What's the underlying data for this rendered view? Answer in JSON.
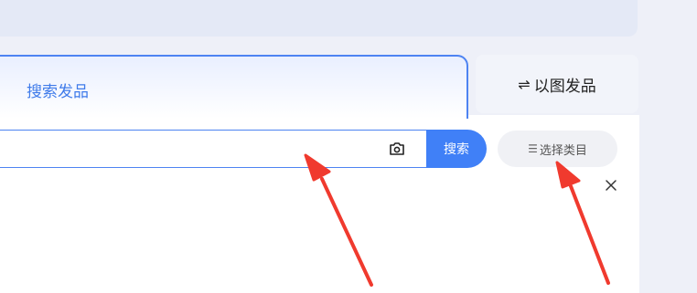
{
  "tabs": {
    "search_label": "搜索发品",
    "image_label": "以图发品",
    "image_icon": "swap-arrows-icon"
  },
  "search": {
    "value": "",
    "placeholder": "",
    "camera_icon": "camera-icon",
    "button_label": "搜索"
  },
  "category": {
    "icon": "list-icon",
    "label": "选择类目"
  },
  "close_icon": "close-icon",
  "colors": {
    "accent": "#4080f7",
    "annotation_arrow": "#f03a2e"
  }
}
